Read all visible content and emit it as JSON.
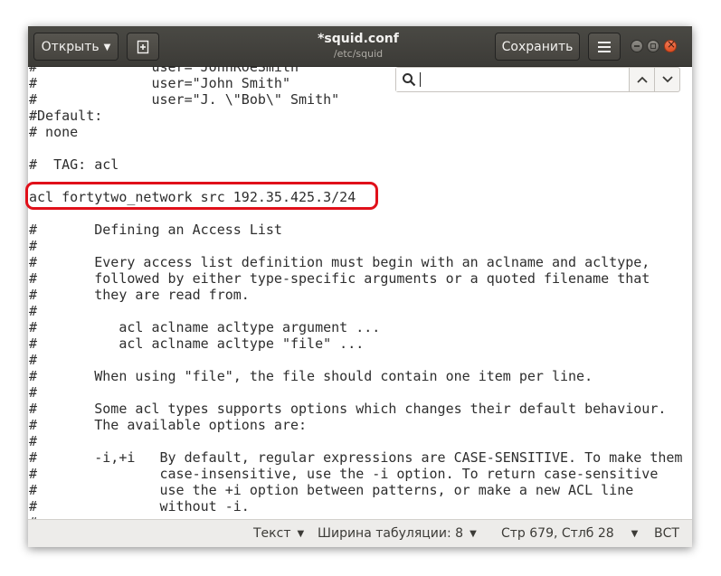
{
  "header": {
    "open_label": "Открыть",
    "save_label": "Сохранить",
    "title": "*squid.conf",
    "subtitle": "/etc/squid"
  },
  "search": {
    "value": ""
  },
  "editor": {
    "lines": [
      "#              user=\"JohnRoeSmith\"",
      "#              user=\"John Smith\"",
      "#              user=\"J. \\\"Bob\\\" Smith\"",
      "#Default:",
      "# none",
      "",
      "#  TAG: acl",
      "",
      "acl fortytwo_network src 192.35.425.3/24",
      "",
      "#       Defining an Access List",
      "#",
      "#       Every access list definition must begin with an aclname and acltype,",
      "#       followed by either type-specific arguments or a quoted filename that",
      "#       they are read from.",
      "#",
      "#          acl aclname acltype argument ...",
      "#          acl aclname acltype \"file\" ...",
      "#",
      "#       When using \"file\", the file should contain one item per line.",
      "#",
      "#       Some acl types supports options which changes their default behaviour.",
      "#       The available options are:",
      "#",
      "#       -i,+i   By default, regular expressions are CASE-SENSITIVE. To make them",
      "#               case-insensitive, use the -i option. To return case-sensitive",
      "#               use the +i option between patterns, or make a new ACL line",
      "#               without -i.",
      "#"
    ]
  },
  "status": {
    "syntax": "Текст",
    "tab_width": "Ширина табуляции: 8",
    "position": "Стр 679, Стлб 28",
    "mode": "ВСТ"
  },
  "colors": {
    "highlight_border": "#e0101a",
    "titlebar": "#3c3b37",
    "close_button": "#df4f22"
  },
  "icons": [
    "new-document-icon",
    "hamburger-menu-icon",
    "search-icon",
    "chevron-up-icon",
    "chevron-down-icon"
  ]
}
